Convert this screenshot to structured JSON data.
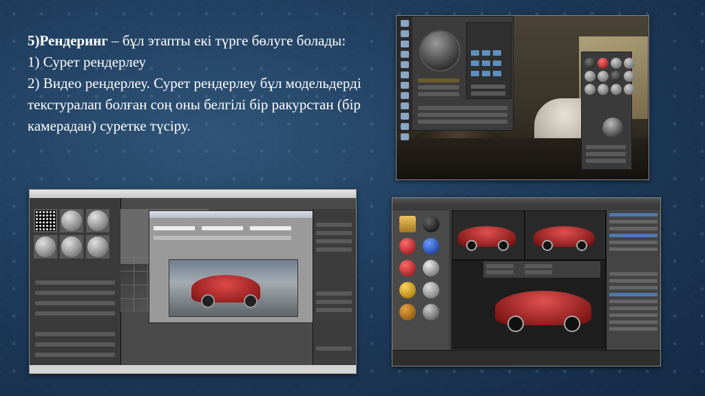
{
  "slide": {
    "heading_bold": "5)Рендеринг",
    "heading_rest": " – бұл этапты екі түрге бөлуге болады:",
    "items": [
      "1) Сурет рендерлеу",
      "2) Видео рендерлеу. Сурет рендерлеу бұл модельдерді текстуралап болған соң оны белгілі бір ракурстан (бір камерадан) суретке түсіру."
    ]
  },
  "screenshots": {
    "top_right": {
      "icon": "material-editor-interior-render"
    },
    "bottom_left": {
      "icon": "3dsmax-render-window-car"
    },
    "bottom_right": {
      "icon": "modo-shader-car-render"
    }
  },
  "colors": {
    "text": "#ffffff",
    "background": "#1f3c5c",
    "car_red": "#c62828"
  }
}
